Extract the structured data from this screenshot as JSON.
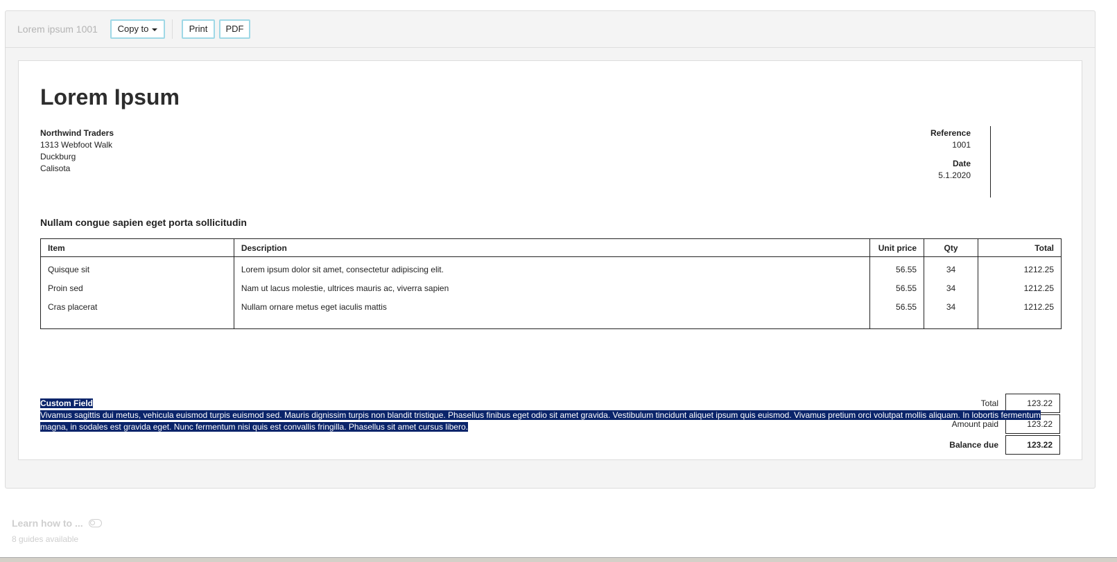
{
  "toolbar": {
    "title": "Lorem ipsum 1001",
    "copy_label": "Copy to",
    "print_label": "Print",
    "pdf_label": "PDF"
  },
  "document": {
    "title": "Lorem Ipsum",
    "sender": {
      "name": "Northwind Traders",
      "street": "1313 Webfoot Walk",
      "city": "Duckburg",
      "region": "Calisota"
    },
    "reference_label": "Reference",
    "reference_value": "1001",
    "date_label": "Date",
    "date_value": "5.1.2020",
    "subject": "Nullam congue sapien eget porta sollicitudin",
    "table": {
      "headers": {
        "item": "Item",
        "description": "Description",
        "unit_price": "Unit price",
        "qty": "Qty",
        "total": "Total"
      },
      "rows": [
        {
          "item": "Quisque sit",
          "description": "Lorem ipsum dolor sit amet, consectetur adipiscing elit.",
          "unit_price": "56.55",
          "qty": "34",
          "total": "1212.25"
        },
        {
          "item": "Proin sed",
          "description": "Nam ut lacus molestie, ultrices mauris ac, viverra sapien",
          "unit_price": "56.55",
          "qty": "34",
          "total": "1212.25"
        },
        {
          "item": "Cras placerat",
          "description": "Nullam ornare metus eget iaculis mattis",
          "unit_price": "56.55",
          "qty": "34",
          "total": "1212.25"
        }
      ]
    },
    "totals": {
      "total_label": "Total",
      "total_value": "123.22",
      "paid_label": "Amount paid",
      "paid_value": "123.22",
      "balance_label": "Balance due",
      "balance_value": "123.22"
    },
    "custom_field": {
      "label": "Custom Field",
      "text": "Vivamus sagittis dui metus, vehicula euismod turpis euismod sed. Mauris dignissim turpis non blandit tristique. Phasellus finibus eget odio sit amet gravida. Vestibulum tincidunt aliquet ipsum quis euismod. Vivamus pretium orci volutpat mollis aliquam. In lobortis fermentum magna, in sodales est gravida eget. Nunc fermentum nisi quis est convallis fringilla. Phasellus sit amet cursus libero."
    }
  },
  "learn": {
    "title": "Learn how to ...",
    "subtitle": "8 guides available"
  },
  "colors": {
    "selection": "#0a246a",
    "button_border": "#9fd8e6",
    "panel_bg": "#f4f4f4"
  }
}
